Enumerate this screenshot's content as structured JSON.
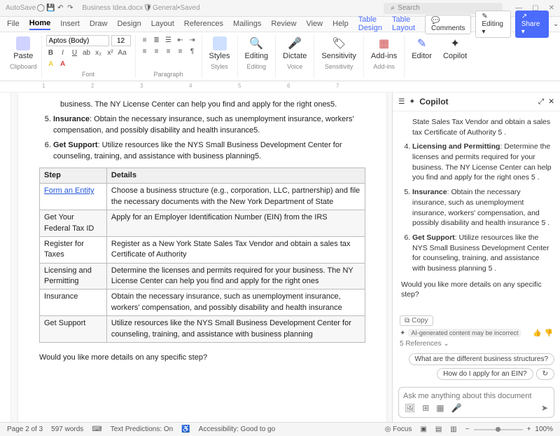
{
  "titlebar": {
    "autosave": "AutoSave",
    "doc": "Business Idea.docx",
    "badge": "General",
    "status": "Saved",
    "search_placeholder": "Search"
  },
  "tabs": [
    "File",
    "Home",
    "Insert",
    "Draw",
    "Design",
    "Layout",
    "References",
    "Mailings",
    "Review",
    "View",
    "Help",
    "Table Design",
    "Table Layout"
  ],
  "right_buttons": {
    "comments": "Comments",
    "editing": "Editing",
    "share": "Share"
  },
  "font": {
    "name": "Aptos (Body)",
    "size": "12"
  },
  "ribbon_groups": [
    "Clipboard",
    "Font",
    "Paragraph",
    "Styles",
    "Editing",
    "Voice",
    "Sensitivity",
    "Add-ins"
  ],
  "ribbon_big": {
    "paste": "Paste",
    "styles": "Styles",
    "editing": "Editing",
    "dictate": "Dictate",
    "sensitivity": "Sensitivity",
    "addins": "Add-ins",
    "editor": "Editor",
    "copilot": "Copilot"
  },
  "doc": {
    "partial": "business. The NY License Center can help you find and apply for the right ones5.",
    "items": [
      {
        "n": "5.",
        "title": "Insurance",
        "text": ": Obtain the necessary insurance, such as unemployment insurance, workers' compensation, and possibly disability and health insurance5."
      },
      {
        "n": "6.",
        "title": "Get Support",
        "text": ": Utilize resources like the NYS Small Business Development Center for counseling, training, and assistance with business planning5."
      }
    ],
    "table": {
      "headers": [
        "Step",
        "Details"
      ],
      "rows": [
        [
          "Form an Entity",
          "Choose a business structure (e.g., corporation, LLC, partnership) and file the necessary documents with the New York Department of State"
        ],
        [
          "Get Your Federal Tax ID",
          "Apply for an Employer Identification Number (EIN) from the IRS"
        ],
        [
          "Register for Taxes",
          "Register as a New York State Sales Tax Vendor and obtain a sales tax Certificate of Authority"
        ],
        [
          "Licensing and Permitting",
          "Determine the licenses and permits required for your business. The NY License Center can help you find and apply for the right ones"
        ],
        [
          "Insurance",
          "Obtain the necessary insurance, such as unemployment insurance, workers' compensation, and possibly disability and health insurance"
        ],
        [
          "Get Support",
          "Utilize resources like the NYS Small Business Development Center for counseling, training, and assistance with business planning"
        ]
      ]
    },
    "followup": "Would you like more details on any specific step?"
  },
  "copilot": {
    "title": "Copilot",
    "partial": "State Sales Tax Vendor and obtain a sales tax Certificate of Authority 5 .",
    "items": [
      {
        "n": "4.",
        "title": "Licensing and Permitting",
        "text": ": Determine the licenses and permits required for your business. The NY License Center can help you find and apply for the right ones 5 ."
      },
      {
        "n": "5.",
        "title": "Insurance",
        "text": ": Obtain the necessary insurance, such as unemployment insurance, workers' compensation, and possibly disability and health insurance 5 ."
      },
      {
        "n": "6.",
        "title": "Get Support",
        "text": ": Utilize resources like the NYS Small Business Development Center for counseling, training, and assistance with business planning 5 ."
      }
    ],
    "followup": "Would you like more details on any specific step?",
    "copy": "Copy",
    "warn": "AI-generated content may be incorrect",
    "refs": "5 References",
    "sugg": [
      "What are the different business structures?",
      "How do I apply for an EIN?"
    ],
    "input_placeholder": "Ask me anything about this document"
  },
  "status": {
    "page": "Page 2 of 3",
    "words": "597 words",
    "pred": "Text Predictions: On",
    "acc": "Accessibility: Good to go",
    "focus": "Focus",
    "zoom": "100%"
  }
}
